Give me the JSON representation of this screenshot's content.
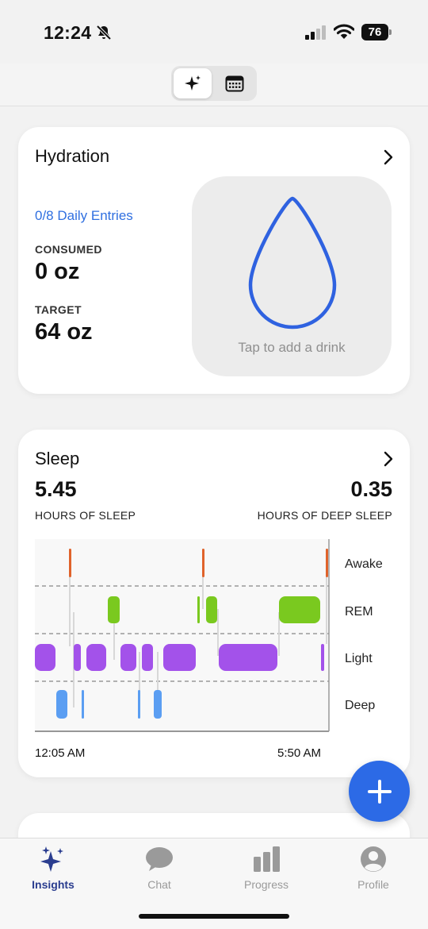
{
  "status_bar": {
    "time": "12:24",
    "battery": "76",
    "icons": [
      "bell-slash-icon",
      "cellular-signal-icon",
      "wifi-icon",
      "battery-icon"
    ]
  },
  "header": {
    "segments": [
      {
        "icon": "sparkles-icon",
        "active": true
      },
      {
        "icon": "calendar-icon",
        "active": false
      }
    ]
  },
  "hydration": {
    "title": "Hydration",
    "entries": "0/8 Daily Entries",
    "consumed_label": "CONSUMED",
    "consumed_value": "0 oz",
    "target_label": "TARGET",
    "target_value": "64 oz",
    "add_hint": "Tap to add a drink",
    "icon": "water-drop-icon"
  },
  "sleep": {
    "title": "Sleep",
    "hours": "5.45",
    "hours_label": "HOURS OF SLEEP",
    "deep_hours": "0.35",
    "deep_label": "HOURS OF DEEP SLEEP",
    "start_time": "12:05 AM",
    "end_time": "5:50 AM",
    "stages": [
      "Awake",
      "REM",
      "Light",
      "Deep"
    ],
    "colors": {
      "Awake": "#e0632b",
      "REM": "#7ac91f",
      "Light": "#a352ea",
      "Deep": "#5b9ef2"
    }
  },
  "tabs": [
    {
      "label": "Insights",
      "icon": "sparkles-icon",
      "active": true
    },
    {
      "label": "Chat",
      "icon": "chat-bubble-icon",
      "active": false
    },
    {
      "label": "Progress",
      "icon": "bar-chart-icon",
      "active": false
    },
    {
      "label": "Profile",
      "icon": "person-icon",
      "active": false
    }
  ],
  "fab": {
    "icon": "plus-icon"
  }
}
